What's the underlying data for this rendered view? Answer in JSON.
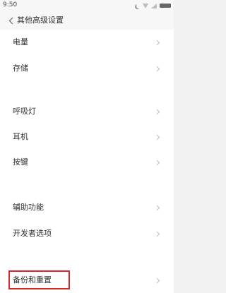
{
  "status_bar": {
    "time": "9:50",
    "icons": [
      "moon-icon",
      "wifi-icon",
      "signal-icon",
      "battery-icon"
    ]
  },
  "header": {
    "back_icon": "chevron-left-icon",
    "title": "其他高级设置"
  },
  "settings": {
    "items": [
      {
        "label": "电量"
      },
      {
        "label": "存储"
      },
      {
        "label": "呼吸灯"
      },
      {
        "label": "耳机"
      },
      {
        "label": "按键"
      },
      {
        "label": "辅助功能"
      },
      {
        "label": "开发者选项"
      },
      {
        "label": "备份和重置"
      }
    ]
  },
  "annotation": {
    "highlight_color": "#d9262c"
  },
  "colors": {
    "background": "#ffffff",
    "header_background": "#f7f7f7",
    "text": "#333333",
    "chevron": "#bdbdbd"
  }
}
